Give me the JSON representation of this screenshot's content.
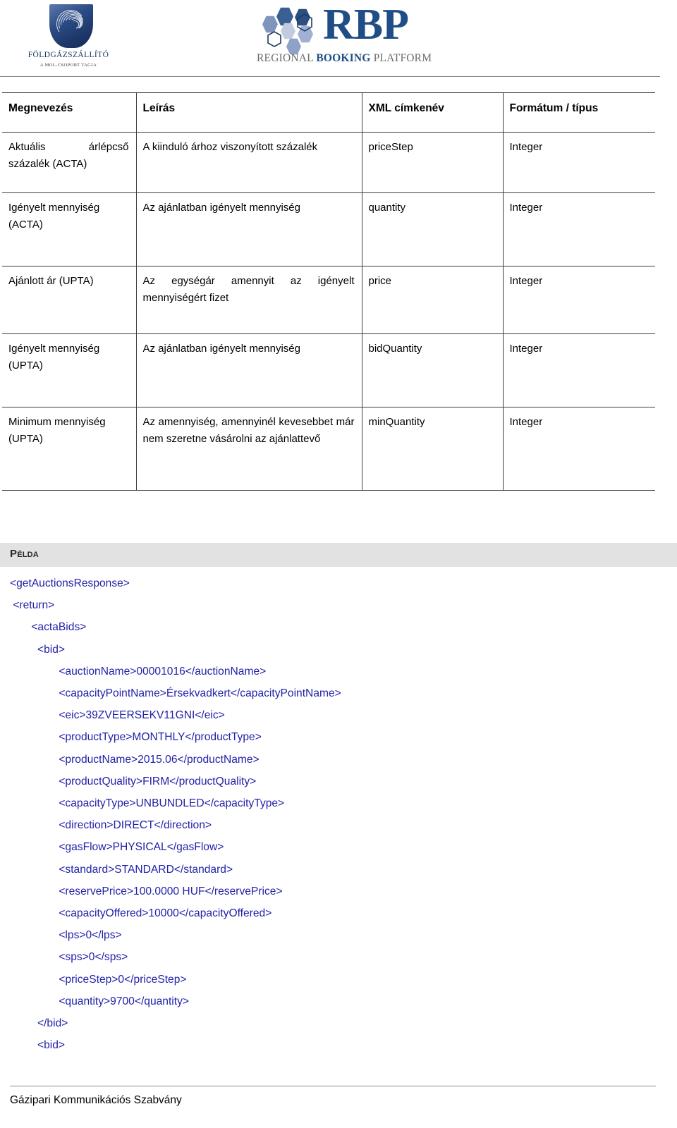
{
  "header": {
    "fgsz_logo": {
      "icon": "fgsz-shield-logo",
      "name": "FÖLDGÁZSZÁLLÍTÓ",
      "subtitle": "A MOL-CSOPORT TAGJA"
    },
    "rbp_logo": {
      "icon": "rbp-hexagon-logo",
      "wordmark": "RBP",
      "tagline_regional": "REGIONAL",
      "tagline_booking": "BOOKING",
      "tagline_platform": "PLATFORM"
    }
  },
  "table": {
    "columns": [
      "Megnevezés",
      "Leírás",
      "XML címkenév",
      "Formátum / típus"
    ],
    "rows": [
      {
        "name": "Aktuális árlépcső százalék (ACTA)",
        "description": "A kiinduló árhoz viszonyított százalék",
        "xml_tag": "priceStep",
        "format": "Integer"
      },
      {
        "name": "Igényelt mennyiség (ACTA)",
        "description": "Az ajánlatban igényelt mennyiség",
        "xml_tag": "quantity",
        "format": "Integer"
      },
      {
        "name": "Ajánlott ár (UPTA)",
        "description": "Az egységár amennyit az igényelt mennyiségért fizet",
        "xml_tag": "price",
        "format": "Integer"
      },
      {
        "name": "Igényelt mennyiség (UPTA)",
        "description": "Az ajánlatban igényelt mennyiség",
        "xml_tag": "bidQuantity",
        "format": "Integer"
      },
      {
        "name": "Minimum mennyiség (UPTA)",
        "description": "Az amennyiség, amennyinél kevesebbet már nem szeretne vásárolni az ajánlattevő",
        "xml_tag": "minQuantity",
        "format": "Integer"
      }
    ]
  },
  "example_section": {
    "heading": "Példa",
    "code": "<getAuctionsResponse>\n <return>\n       <actaBids>\n         <bid>\n                <auctionName>00001016</auctionName>\n                <capacityPointName>Érsekvadkert</capacityPointName>\n                <eic>39ZVEERSEKV11GNI</eic>\n                <productType>MONTHLY</productType>\n                <productName>2015.06</productName>\n                <productQuality>FIRM</productQuality>\n                <capacityType>UNBUNDLED</capacityType>\n                <direction>DIRECT</direction>\n                <gasFlow>PHYSICAL</gasFlow>\n                <standard>STANDARD</standard>\n                <reservePrice>100.0000 HUF</reservePrice>\n                <capacityOffered>10000</capacityOffered>\n                <lps>0</lps>\n                <sps>0</sps>\n                <priceStep>0</priceStep>\n                <quantity>9700</quantity>\n         </bid>\n         <bid>"
  },
  "footer": {
    "text": "Gázipari Kommunikációs Szabvány"
  },
  "colors": {
    "xml_text": "#2222aa",
    "brand_blue": "#1f4d86",
    "shield_blue": "#1d3769",
    "band_gray": "#e2e2e2",
    "rule_gray": "#8a8a8a"
  }
}
